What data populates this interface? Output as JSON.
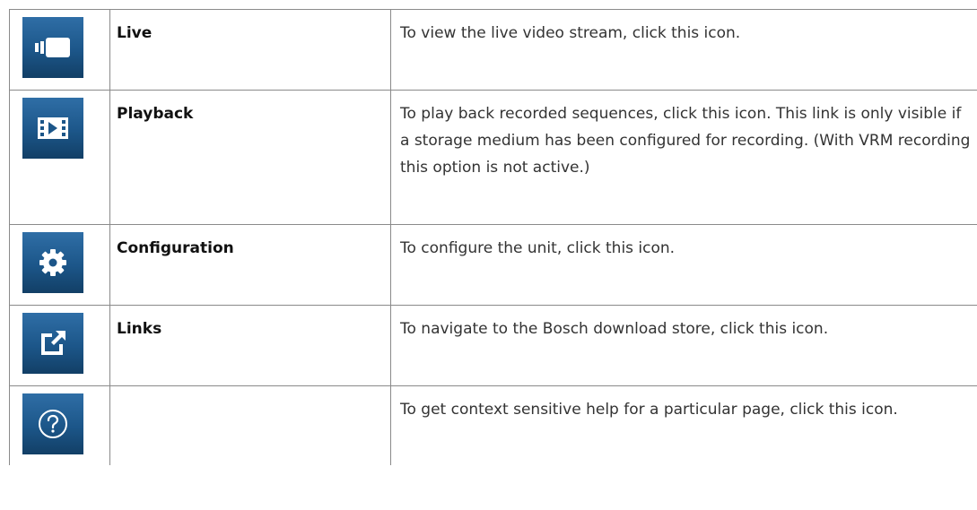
{
  "rows": [
    {
      "icon": "video-camera-icon",
      "name": "Live",
      "description": "To view the live video stream, click this icon."
    },
    {
      "icon": "playback-film-icon",
      "name": "Playback",
      "description": "To play back recorded sequences, click this icon. This link is only visible if a storage medium has been configured for recording. (With VRM recording this option is not active.)"
    },
    {
      "icon": "gear-icon",
      "name": "Configuration",
      "description": "To configure the unit, click this icon."
    },
    {
      "icon": "external-link-icon",
      "name": "Links",
      "description": "To navigate to the Bosch download store, click this icon."
    },
    {
      "icon": "help-question-icon",
      "name": "",
      "description": "To get context sensitive help for a particular page, click this icon."
    }
  ],
  "colors": {
    "icon_bg_top": "#2f6ea6",
    "icon_bg_bottom": "#123f66",
    "border": "#8a8a8a"
  }
}
